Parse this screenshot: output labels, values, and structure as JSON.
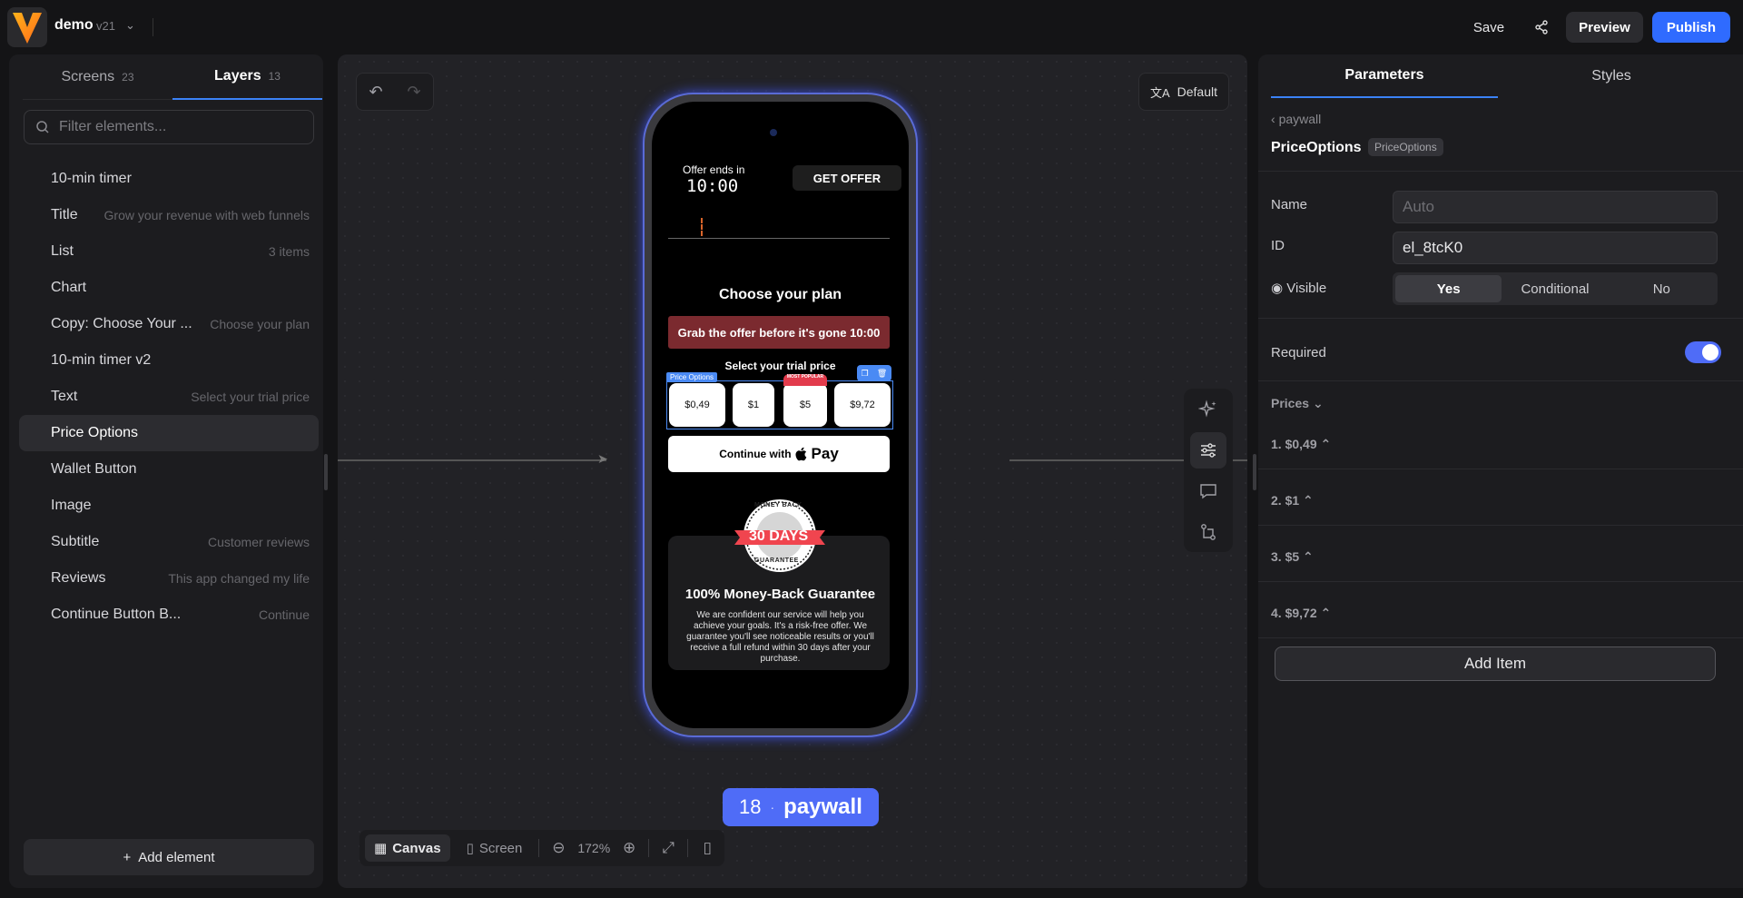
{
  "topbar": {
    "project": "demo",
    "version": "v21",
    "save": "Save",
    "preview": "Preview",
    "publish": "Publish"
  },
  "left": {
    "tabs": [
      {
        "label": "Screens",
        "count": "23"
      },
      {
        "label": "Layers",
        "count": "13"
      }
    ],
    "filter_placeholder": "Filter elements...",
    "items": [
      {
        "name": "10-min timer",
        "hint": ""
      },
      {
        "name": "Title",
        "hint": "Grow your revenue with web funnels"
      },
      {
        "name": "List",
        "hint": "3 items"
      },
      {
        "name": "Chart",
        "hint": ""
      },
      {
        "name": "Copy: Choose Your ...",
        "hint": "Choose your plan"
      },
      {
        "name": "10-min timer v2",
        "hint": ""
      },
      {
        "name": "Text",
        "hint": "Select your trial price"
      },
      {
        "name": "Price Options",
        "hint": ""
      },
      {
        "name": "Wallet Button",
        "hint": ""
      },
      {
        "name": "Image",
        "hint": ""
      },
      {
        "name": "Subtitle",
        "hint": "Customer reviews"
      },
      {
        "name": "Reviews",
        "hint": "This app changed my life"
      },
      {
        "name": "Continue Button B...",
        "hint": "Continue"
      }
    ],
    "add_element": "Add element"
  },
  "canvas": {
    "locale": "Default",
    "view_canvas": "Canvas",
    "view_screen": "Screen",
    "zoom": "172%"
  },
  "phone": {
    "offer_ends": "Offer ends in",
    "timer": "10:00",
    "get_offer": "GET OFFER",
    "choose_plan": "Choose your plan",
    "grab_offer": "Grab the offer before it's gone 10:00",
    "trial_price": "Select your trial price",
    "price_options_tag": "Price Options",
    "prices": [
      "$0,49",
      "$1",
      "$5",
      "$9,72"
    ],
    "most_popular": "MOST POPULAR",
    "continue_with": "Continue with",
    "pay": "Pay",
    "badge_top": "MONEY BACK",
    "badge_days": "30 DAYS",
    "badge_bottom": "GUARANTEE",
    "guarantee_title": "100% Money-Back Guarantee",
    "guarantee_text": "We are confident our service will help you achieve your goals. It's a risk-free offer. We guarantee you'll see noticeable results or you'll receive a full refund within 30 days after your purchase."
  },
  "screen_label": {
    "number": "18",
    "name": "paywall"
  },
  "right": {
    "tabs": [
      "Parameters",
      "Styles"
    ],
    "breadcrumb": "paywall",
    "component": "PriceOptions",
    "component_tag": "PriceOptions",
    "name_label": "Name",
    "name_placeholder": "Auto",
    "id_label": "ID",
    "id_value": "el_8tcK0",
    "visible_label": "Visible",
    "visible_options": [
      "Yes",
      "Conditional",
      "No"
    ],
    "required_label": "Required",
    "prices_label": "Prices",
    "price_items": [
      "1. $0,49",
      "2. $1",
      "3. $5",
      "4. $9,72"
    ],
    "add_item": "Add Item"
  },
  "colors": {
    "accent": "#2f6bff",
    "selection": "#4a8af4",
    "offer_banner": "#7b2a2f",
    "badge_red": "#e23b4c"
  }
}
